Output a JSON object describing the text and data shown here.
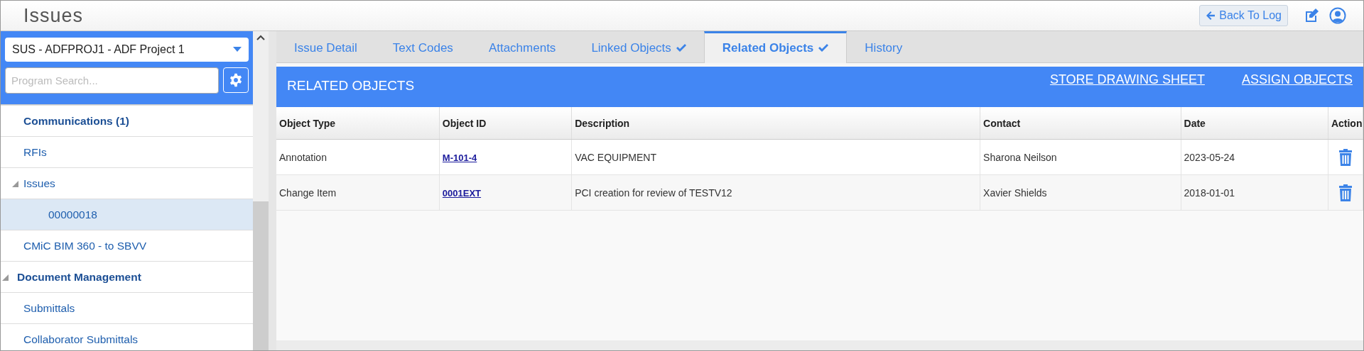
{
  "header": {
    "title": "Issues",
    "back_button": "Back To Log"
  },
  "sidebar": {
    "project_select": {
      "value": "SUS - ADFPROJ1 - ADF Project 1"
    },
    "search": {
      "placeholder": "Program Search..."
    },
    "tree": [
      {
        "children": [
          {
            "label": "Communications (1)",
            "kind": "heading",
            "selected": false
          },
          {
            "label": "RFIs",
            "kind": "item",
            "selected": false
          },
          {
            "label": "Issues",
            "kind": "item",
            "selected": false,
            "expanded": true,
            "children": [
              {
                "label": "00000018",
                "kind": "item",
                "selected": true
              }
            ]
          },
          {
            "label": "CMiC BIM 360 - to SBVV",
            "kind": "item",
            "selected": false
          }
        ]
      },
      {
        "label": "Document Management",
        "kind": "heading",
        "selected": false,
        "expanded": true,
        "children": [
          {
            "label": "Submittals",
            "kind": "item",
            "selected": false
          },
          {
            "label": "Collaborator Submittals",
            "kind": "item",
            "selected": false
          }
        ]
      }
    ]
  },
  "tabs": [
    {
      "label": "Issue Detail",
      "selected": false,
      "checked": false
    },
    {
      "label": "Text Codes",
      "selected": false,
      "checked": false
    },
    {
      "label": "Attachments",
      "selected": false,
      "checked": false
    },
    {
      "label": "Linked Objects",
      "selected": false,
      "checked": true
    },
    {
      "label": "Related Objects",
      "selected": true,
      "checked": true
    },
    {
      "label": "History",
      "selected": false,
      "checked": false
    }
  ],
  "section": {
    "title": "RELATED OBJECTS",
    "links": [
      "STORE DRAWING SHEET",
      "ASSIGN OBJECTS"
    ]
  },
  "table": {
    "columns": [
      "Object Type",
      "Object ID",
      "Description",
      "Contact",
      "Date",
      "Action"
    ],
    "rows": [
      {
        "object_type": "Annotation",
        "object_id": "M-101-4",
        "description": "VAC EQUIPMENT",
        "contact": "Sharona Neilson",
        "date": "2023-05-24"
      },
      {
        "object_type": "Change Item",
        "object_id": "0001EXT",
        "description": "PCI creation for review of TESTV12",
        "contact": "Xavier Shields",
        "date": "2018-01-01"
      }
    ]
  }
}
